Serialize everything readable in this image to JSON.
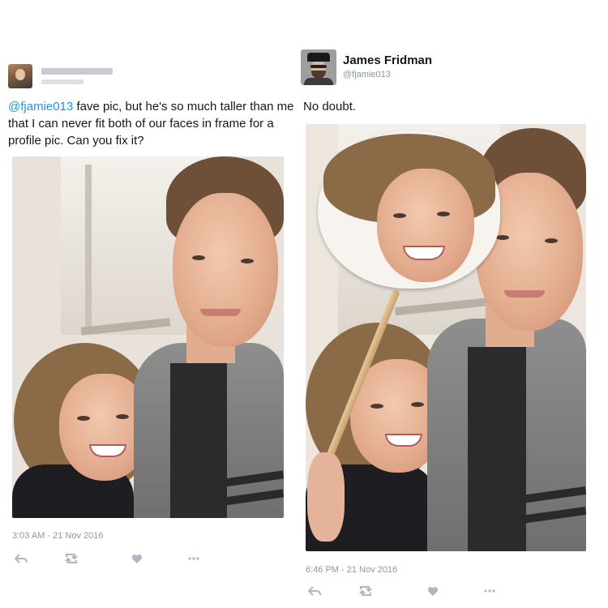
{
  "left_tweet": {
    "text_mention": "@fjamie013",
    "text_body": " fave pic, but he's so much taller than me that I can never fit both of our faces in frame for a profile pic. Can you fix it?",
    "timestamp": "3:03 AM - 21 Nov 2016",
    "icons": [
      "reply-icon",
      "retweet-icon",
      "like-icon",
      "more-icon"
    ]
  },
  "right_tweet": {
    "display_name": "James Fridman",
    "handle": "@fjamie013",
    "text": "No doubt.",
    "timestamp": "6:46 PM - 21 Nov 2016",
    "icons": [
      "reply-icon",
      "retweet-icon",
      "like-icon",
      "more-icon"
    ]
  },
  "colors": {
    "link": "#1b95e0",
    "meta": "#8899a6",
    "icon": "#aab8c2",
    "text": "#14171a"
  }
}
